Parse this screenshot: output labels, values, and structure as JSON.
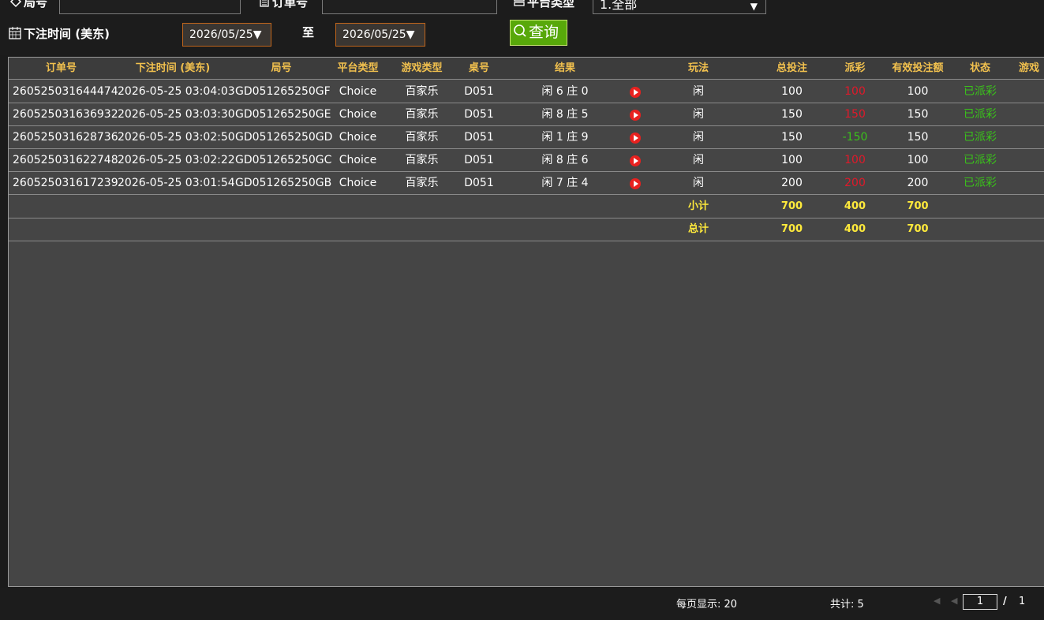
{
  "filters": {
    "round_label": "局号",
    "order_label": "订单号",
    "platform_label": "平台类型",
    "platform_value": "1.全部",
    "bet_time_label": "下注时间 (美东)",
    "date_from": "2026/05/25▼",
    "to_label": "至",
    "date_to": "2026/05/25▼",
    "query_label": "查询"
  },
  "table": {
    "headers": [
      "订单号",
      "下注时间 (美东)",
      "局号",
      "平台类型",
      "游戏类型",
      "桌号",
      "结果",
      "",
      "玩法",
      "总投注",
      "派彩",
      "有效投注额",
      "状态",
      "游戏"
    ],
    "rows": [
      {
        "order": "260525031644474",
        "time": "2026-05-25 03:04:03",
        "round": "GD051265250GF",
        "platform": "Choice",
        "game": "百家乐",
        "table": "D051",
        "result": "闲 6 庄 0",
        "play": "闲",
        "bet": "100",
        "payout": "100",
        "payout_color": "red",
        "valid": "100",
        "status": "已派彩"
      },
      {
        "order": "260525031636932",
        "time": "2026-05-25 03:03:30",
        "round": "GD051265250GE",
        "platform": "Choice",
        "game": "百家乐",
        "table": "D051",
        "result": "闲 8 庄 5",
        "play": "闲",
        "bet": "150",
        "payout": "150",
        "payout_color": "red",
        "valid": "150",
        "status": "已派彩"
      },
      {
        "order": "260525031628736",
        "time": "2026-05-25 03:02:50",
        "round": "GD051265250GD",
        "platform": "Choice",
        "game": "百家乐",
        "table": "D051",
        "result": "闲 1 庄 9",
        "play": "闲",
        "bet": "150",
        "payout": "-150",
        "payout_color": "green",
        "valid": "150",
        "status": "已派彩"
      },
      {
        "order": "260525031622748",
        "time": "2026-05-25 03:02:22",
        "round": "GD051265250GC",
        "platform": "Choice",
        "game": "百家乐",
        "table": "D051",
        "result": "闲 8 庄 6",
        "play": "闲",
        "bet": "100",
        "payout": "100",
        "payout_color": "red",
        "valid": "100",
        "status": "已派彩"
      },
      {
        "order": "260525031617239",
        "time": "2026-05-25 03:01:54",
        "round": "GD051265250GB",
        "platform": "Choice",
        "game": "百家乐",
        "table": "D051",
        "result": "闲 7 庄 4",
        "play": "闲",
        "bet": "200",
        "payout": "200",
        "payout_color": "red",
        "valid": "200",
        "status": "已派彩"
      }
    ],
    "subtotal": {
      "label": "小计",
      "bet": "700",
      "payout": "400",
      "valid": "700"
    },
    "total": {
      "label": "总计",
      "bet": "700",
      "payout": "400",
      "valid": "700"
    }
  },
  "footer": {
    "per_page": "每页显示: 20",
    "total_count": "共计: 5",
    "page_current": "1",
    "page_sep": "/",
    "page_total": "1"
  },
  "colors": {
    "header_text": "#f2c14e",
    "red": "#e0192a",
    "green": "#3ac21a",
    "yellow": "#ffea3b",
    "query_button": "#58a80a"
  }
}
